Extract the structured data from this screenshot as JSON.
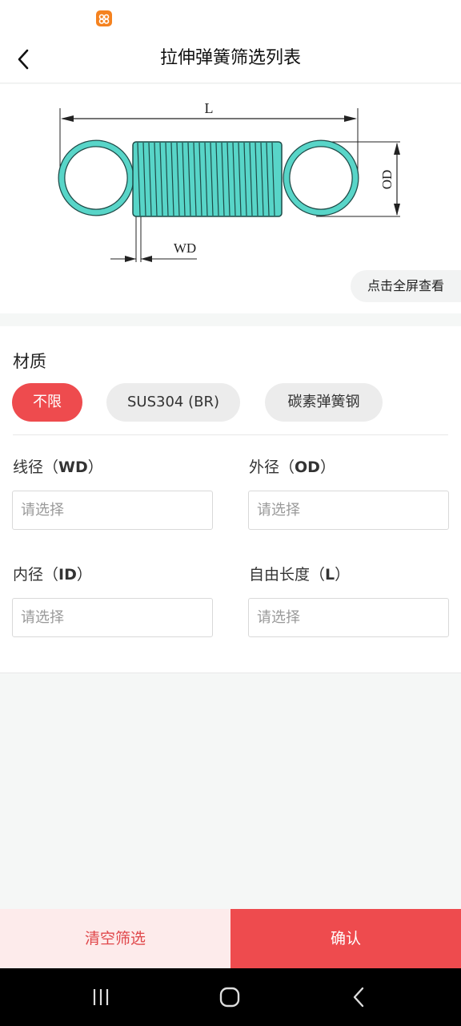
{
  "header": {
    "title": "拉伸弹簧筛选列表",
    "back_icon": "chevron-left-icon"
  },
  "diagram": {
    "label_length": "L",
    "label_outer_diameter": "OD",
    "label_wire_diameter": "WD",
    "spring_color": "#58d5c8",
    "fullscreen_label": "点击全屏查看"
  },
  "filters": {
    "material_title": "材质",
    "material_options": [
      "不限",
      "SUS304 (BR)",
      "碳素弹簧钢"
    ],
    "material_selected": "不限",
    "fields": [
      {
        "label": "线径（",
        "code": "WD",
        "suffix": "）",
        "placeholder": "请选择"
      },
      {
        "label": "外径（",
        "code": "OD",
        "suffix": "）",
        "placeholder": "请选择"
      },
      {
        "label": "内径（",
        "code": "ID",
        "suffix": "）",
        "placeholder": "请选择"
      },
      {
        "label": "自由长度（",
        "code": "L",
        "suffix": "）",
        "placeholder": "请选择"
      }
    ]
  },
  "actions": {
    "clear_label": "清空筛选",
    "confirm_label": "确认"
  },
  "colors": {
    "accent": "#ee4b4e",
    "accent_light": "#fdebeb"
  },
  "system_nav": {
    "icons": [
      "recent-apps-icon",
      "home-icon",
      "back-icon"
    ]
  }
}
